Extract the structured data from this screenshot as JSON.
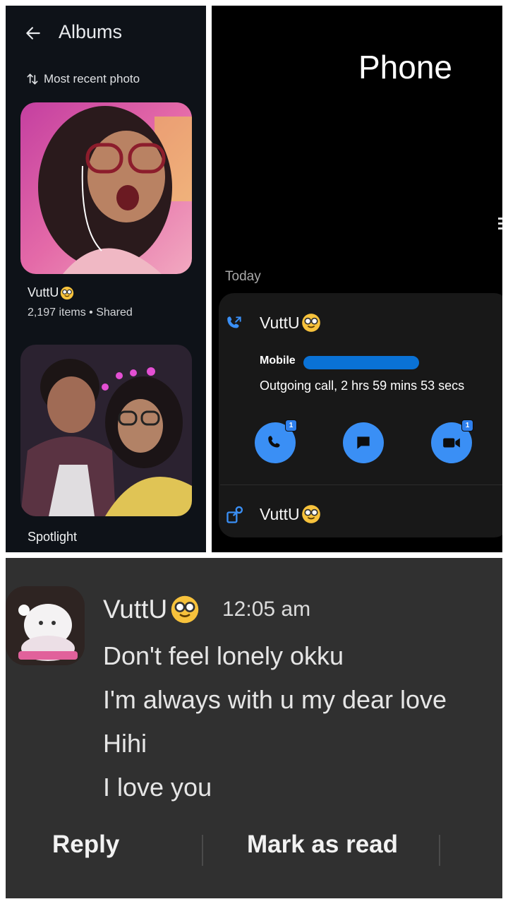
{
  "albums": {
    "title": "Albums",
    "sort_label": "Most recent photo",
    "items": [
      {
        "name": "VuttU",
        "meta": "2,197 items • Shared"
      },
      {
        "name": "Spotlight",
        "meta": ""
      }
    ]
  },
  "phone": {
    "title": "Phone",
    "section_label": "Today",
    "call": {
      "contact_name": "VuttU",
      "number_label": "Mobile",
      "detail": "Outgoing call, 2 hrs 59 mins 53 secs",
      "actions": [
        {
          "icon": "phone-icon",
          "badge": "1"
        },
        {
          "icon": "message-icon",
          "badge": ""
        },
        {
          "icon": "video-call-icon",
          "badge": "1"
        }
      ]
    },
    "profile_row": {
      "contact_name": "VuttU"
    }
  },
  "notification": {
    "sender": "VuttU",
    "time": "12:05 am",
    "messages": [
      "Don't feel lonely okku",
      "I'm always with u my dear love",
      "Hihi",
      "I love you"
    ],
    "actions": {
      "reply": "Reply",
      "mark_read": "Mark as read"
    }
  },
  "colors": {
    "accent_blue": "#3a8ff5",
    "albums_bg": "#0e1218",
    "notification_bg": "#303030"
  }
}
